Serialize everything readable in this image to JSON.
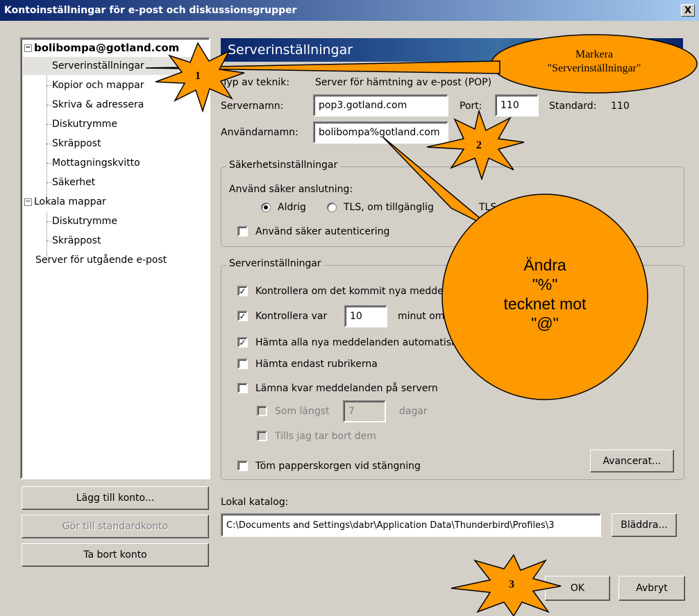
{
  "window": {
    "title": "Kontoinställningar för e-post och diskussionsgrupper",
    "close_label": "X"
  },
  "tree": {
    "root": "bolibompa@gotland.com",
    "root_children": [
      "Serverinställningar",
      "Kopior och mappar",
      "Skriva & adressera",
      "Diskutrymme",
      "Skräppost",
      "Mottagningskvitto",
      "Säkerhet"
    ],
    "local": "Lokala mappar",
    "local_children": [
      "Diskutrymme",
      "Skräppost"
    ],
    "outgoing": "Server för utgående e-post",
    "expander": "−"
  },
  "left_buttons": {
    "add": "Lägg till konto...",
    "default": "Gör till standardkonto",
    "remove": "Ta bort konto"
  },
  "panel": {
    "title": "Serverinställningar",
    "server_type_label": "Typ av teknik:",
    "server_type_value": "Server för hämtning av e-post (POP)",
    "servername_label": "Servernamn:",
    "servername_value": "pop3.gotland.com",
    "port_label": "Port:",
    "port_value": "110",
    "standard_label": "Standard:",
    "standard_value": "110",
    "username_label": "Användarnamn:",
    "username_value": "bolibompa%gotland.com",
    "security": {
      "legend": "Säkerhetsinställningar",
      "use_secure_label": "Använd säker anslutning:",
      "opt_never": "Aldrig",
      "opt_tls_avail": "TLS, om tillgänglig",
      "opt_tls": "TLS",
      "secure_auth_label": "Använd säker autenticering"
    },
    "server": {
      "legend": "Serverinställningar",
      "check_new_label": "Kontrollera om det kommit nya meddelanden vid start",
      "check_every_label": "Kontrollera var",
      "check_every_value": "10",
      "check_every_suffix": "minut om",
      "fetch_auto_label": "Hämta alla nya meddelanden automatiskt",
      "headers_only_label": "Hämta endast rubrikerna",
      "leave_on_server_label": "Lämna kvar meddelanden på servern",
      "at_most_label": "Som längst",
      "at_most_value": "7",
      "days_label": "dagar",
      "until_deleted_label": "Tills jag tar bort dem",
      "empty_trash_label": "Töm papperskorgen vid stängning",
      "advanced_button": "Avancerat..."
    },
    "local_dir_label": "Lokal katalog:",
    "local_dir_value": "C:\\Documents and Settings\\dabr\\Application Data\\Thunderbird\\Profiles\\3",
    "browse_button": "Bläddra..."
  },
  "footer": {
    "ok": "OK",
    "cancel": "Avbryt"
  },
  "callouts": {
    "mark_line1": "Markera",
    "mark_line2": "\"Serverinställningar\"",
    "change_line1": "Ändra",
    "change_line2": "\"%\"",
    "change_line3": "tecknet mot",
    "change_line4": "\"@\"",
    "star1": "1",
    "star2": "2",
    "star3": "3"
  },
  "colors": {
    "callout_fill": "#ff9900",
    "titlebar": "#0a246a",
    "window": "#d4d0c8"
  }
}
